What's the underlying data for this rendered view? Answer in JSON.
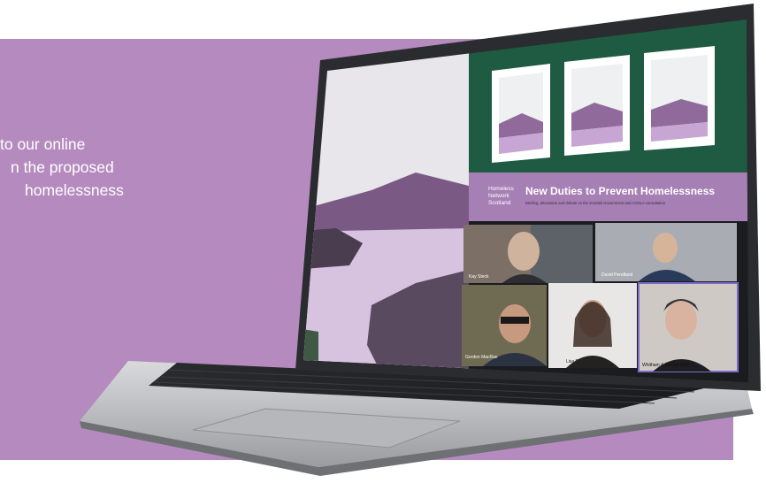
{
  "intro": {
    "line1": "to our online",
    "line2": "n the proposed",
    "line3": " homelessness"
  },
  "screen": {
    "logo": {
      "line1": "Homeless",
      "line2": "Network",
      "line3": "Scotland"
    },
    "banner_title": "New Duties to Prevent Homelessness",
    "banner_subtitle": "Briefing, discussion and debate on the Scottish Government and COSLA consultation",
    "participants": [
      {
        "name": "Kay Steck"
      },
      {
        "name": "David Pendland"
      },
      {
        "name": "Gordon MacRae"
      },
      {
        "name": "Lisa Fraser"
      },
      {
        "name": "Whitham & Ellerby MSP"
      }
    ]
  },
  "colors": {
    "panel": "#b58bbf",
    "screen_green": "#1f5a42",
    "banner_purple": "#a67fb5"
  }
}
